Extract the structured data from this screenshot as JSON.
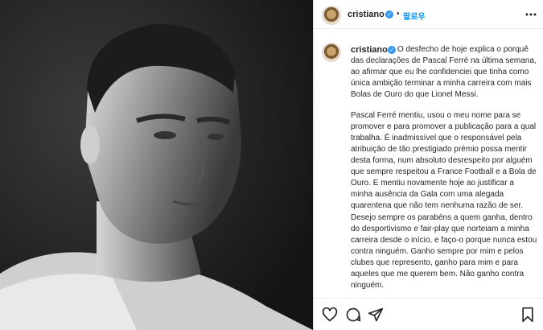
{
  "header": {
    "username": "cristiano",
    "verified_mark": "✓",
    "separator": "•",
    "follow_label": "팔로우",
    "more_icon": "more-options-icon"
  },
  "caption": {
    "username": "cristiano",
    "verified_mark": "✓",
    "paragraphs": [
      "O desfecho de hoje explica o porquê das declarações de Pascal Ferré na última semana, ao afirmar que eu lhe confidenciei que tinha como única ambição terminar a minha carreira com mais Bolas de Ouro do que Lionel Messi.",
      "Pascal Ferré mentiu, usou o meu nome para se promover e para promover a publicação para a qual trabalha. É inadmissível que o responsável pela atribuição de tão prestigiado prémio possa mentir desta forma, num absoluto desrespeito por alguém que sempre respeitou a France Football e a Bola de Ouro. E mentiu novamente hoje ao justificar a minha ausência da Gala com uma alegada quarentena que não tem nenhuma razão de ser.",
      "Desejo sempre os parabéns a quem ganha, dentro do desportivismo e fair-play que norteiam a minha carreira desde o início, e faço-o porque nunca estou contra ninguém. Ganho sempre por mim e pelos clubes que represento, ganho para mim e para aqueles que me querem bem. Não ganho contra ninguém."
    ]
  },
  "actions": {
    "icons": [
      "heart-icon",
      "comment-icon",
      "share-icon",
      "bookmark-icon"
    ]
  },
  "colors": {
    "accent": "#0095f6",
    "verified": "#3897f0",
    "text": "#262626",
    "border": "#dbdbdb"
  }
}
